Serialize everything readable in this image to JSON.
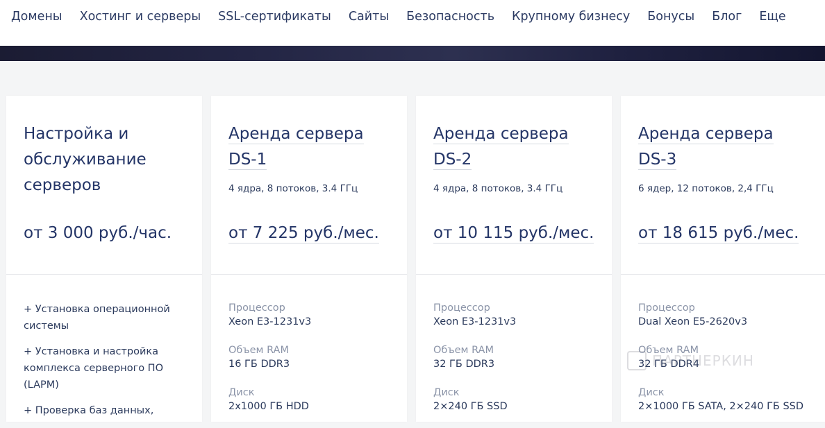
{
  "nav": {
    "items": [
      "Домены",
      "Хостинг и серверы",
      "SSL-сертификаты",
      "Сайты",
      "Безопасность",
      "Крупному бизнесу",
      "Бонусы",
      "Блог",
      "Еще"
    ]
  },
  "cards": [
    {
      "title_l1": "Настройка и",
      "title_l2": "обслуживание",
      "title_l3": "серверов",
      "price": "от 3 000 руб./час.",
      "features": [
        "+ Установка операционной системы",
        "+ Установка и настройка комплекса серверного ПО (LAPM)",
        "+ Проверка баз данных,"
      ]
    },
    {
      "title_l1": "Аренда сервера",
      "title_l2": "DS-1",
      "subtitle": "4 ядра, 8 потоков, 3.4 ГГц",
      "price": "от 7 225 руб./мес.",
      "specs": [
        {
          "label": "Процессор",
          "value": "Xeon E3-1231v3"
        },
        {
          "label": "Объем RAM",
          "value": "16 ГБ DDR3"
        },
        {
          "label": "Диск",
          "value": "2x1000 ГБ HDD"
        }
      ]
    },
    {
      "title_l1": "Аренда сервера",
      "title_l2": "DS-2",
      "subtitle": "4 ядра, 8 потоков, 3.4 ГГц",
      "price": "от 10 115 руб./мес.",
      "specs": [
        {
          "label": "Процессор",
          "value": "Xeon E3-1231v3"
        },
        {
          "label": "Объем RAM",
          "value": "32 ГБ DDR3"
        },
        {
          "label": "Диск",
          "value": "2×240 ГБ SSD"
        }
      ]
    },
    {
      "title_l1": "Аренда сервера",
      "title_l2": "DS-3",
      "subtitle": "6 ядер, 12 потоков, 2,4 ГГц",
      "price": "от 18 615 руб./мес.",
      "specs": [
        {
          "label": "Процессор",
          "value": "Dual Xeon E5-2620v3"
        },
        {
          "label": "Объем RAM",
          "value": "32 ГБ DDR4"
        },
        {
          "label": "Диск",
          "value": "2×1000 ГБ SATA, 2×240 ГБ SSD"
        }
      ]
    }
  ],
  "watermark": "ПАРТНЕРКИН",
  "colors": {
    "accent": "#243567",
    "muted": "#8b94a8",
    "background": "#f4f5f6"
  }
}
